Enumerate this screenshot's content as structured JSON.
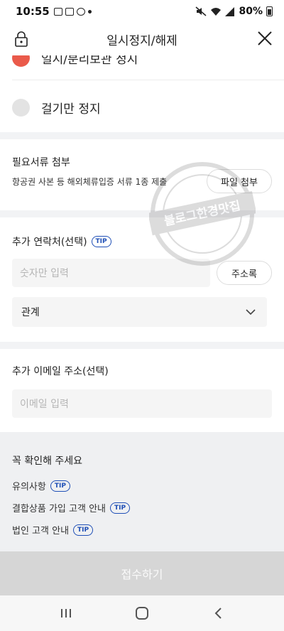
{
  "status_bar": {
    "time": "10:55",
    "battery": "80%"
  },
  "header": {
    "title": "일시정지/해제"
  },
  "radio_options": [
    {
      "label": "일시/분리보관 정지",
      "selected": true
    },
    {
      "label": "걸기만 정지",
      "selected": false
    }
  ],
  "documents": {
    "title": "필요서류 첨부",
    "subtitle": "항공권 사본 등 해외체류입증 서류 1종 제출",
    "button_label": "파일 첨부"
  },
  "contact": {
    "title": "추가 연락처(선택)",
    "tip": "TIP",
    "placeholder": "숫자만 입력",
    "address_book_label": "주소록",
    "relation_label": "관계"
  },
  "email": {
    "title": "추가 이메일 주소(선택)",
    "placeholder": "이메일 입력"
  },
  "notice": {
    "title": "꼭 확인해 주세요",
    "items": [
      {
        "label": "유의사항",
        "tip": "TIP"
      },
      {
        "label": "결합상품 가입 고객 안내",
        "tip": "TIP"
      },
      {
        "label": "법인 고객 안내",
        "tip": "TIP"
      }
    ]
  },
  "submit": {
    "label": "접수하기"
  },
  "watermark": {
    "text": "블로그한경맛집"
  },
  "colors": {
    "accent_red": "#ea5a4a",
    "tip_blue": "#1f4fb6",
    "submit_disabled": "#d6d6d6"
  }
}
